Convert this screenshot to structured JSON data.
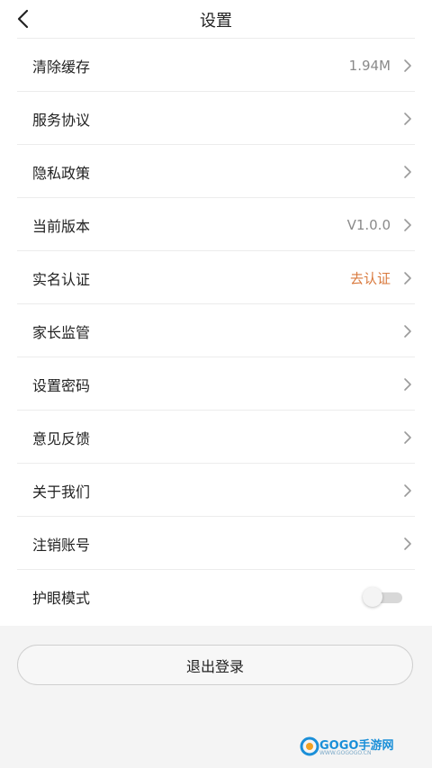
{
  "header": {
    "title": "设置"
  },
  "settings": {
    "items": [
      {
        "label": "清除缓存",
        "value": "1.94M"
      },
      {
        "label": "服务协议",
        "value": ""
      },
      {
        "label": "隐私政策",
        "value": ""
      },
      {
        "label": "当前版本",
        "value": "V1.0.0"
      },
      {
        "label": "实名认证",
        "value": "去认证"
      },
      {
        "label": "家长监管",
        "value": ""
      },
      {
        "label": "设置密码",
        "value": ""
      },
      {
        "label": "意见反馈",
        "value": ""
      },
      {
        "label": "关于我们",
        "value": ""
      },
      {
        "label": "注销账号",
        "value": ""
      },
      {
        "label": "护眼模式",
        "toggle": false
      }
    ]
  },
  "footer": {
    "logout_label": "退出登录"
  },
  "watermark": {
    "brand": "GOGO手游网",
    "domain": "WWW.GOGOGO.CN"
  },
  "colors": {
    "accent": "#d9793d",
    "footer_bg": "#f4f4f4",
    "divider": "#ececec"
  },
  "icons": {
    "back": "chevron-left-icon",
    "row_arrow": "chevron-right-icon"
  }
}
